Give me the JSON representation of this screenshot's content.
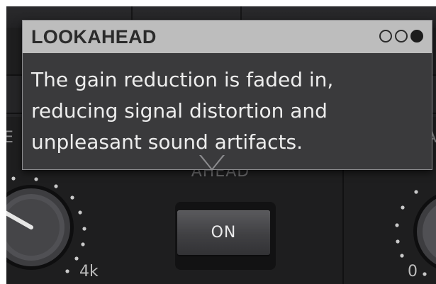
{
  "tooltip": {
    "title": "LOOKAHEAD",
    "lines": [
      "The gain reduction is faded in,",
      "reducing signal distortion and",
      "unpleasant sound artifacts."
    ],
    "pages": 3,
    "current_page": 3
  },
  "lookahead_button": {
    "label": "ON"
  },
  "section_label": "AHEAD",
  "partial_labels": {
    "left": "E",
    "right": "A"
  },
  "left_knob": {
    "scale_label": "4k"
  },
  "right_knob": {
    "scale_label": "0"
  },
  "colors": {
    "panel": "#1e1e1f",
    "tooltip_header": "#bdbdbd",
    "tooltip_body": "#3a3a3c",
    "tooltip_text": "#ededed"
  }
}
